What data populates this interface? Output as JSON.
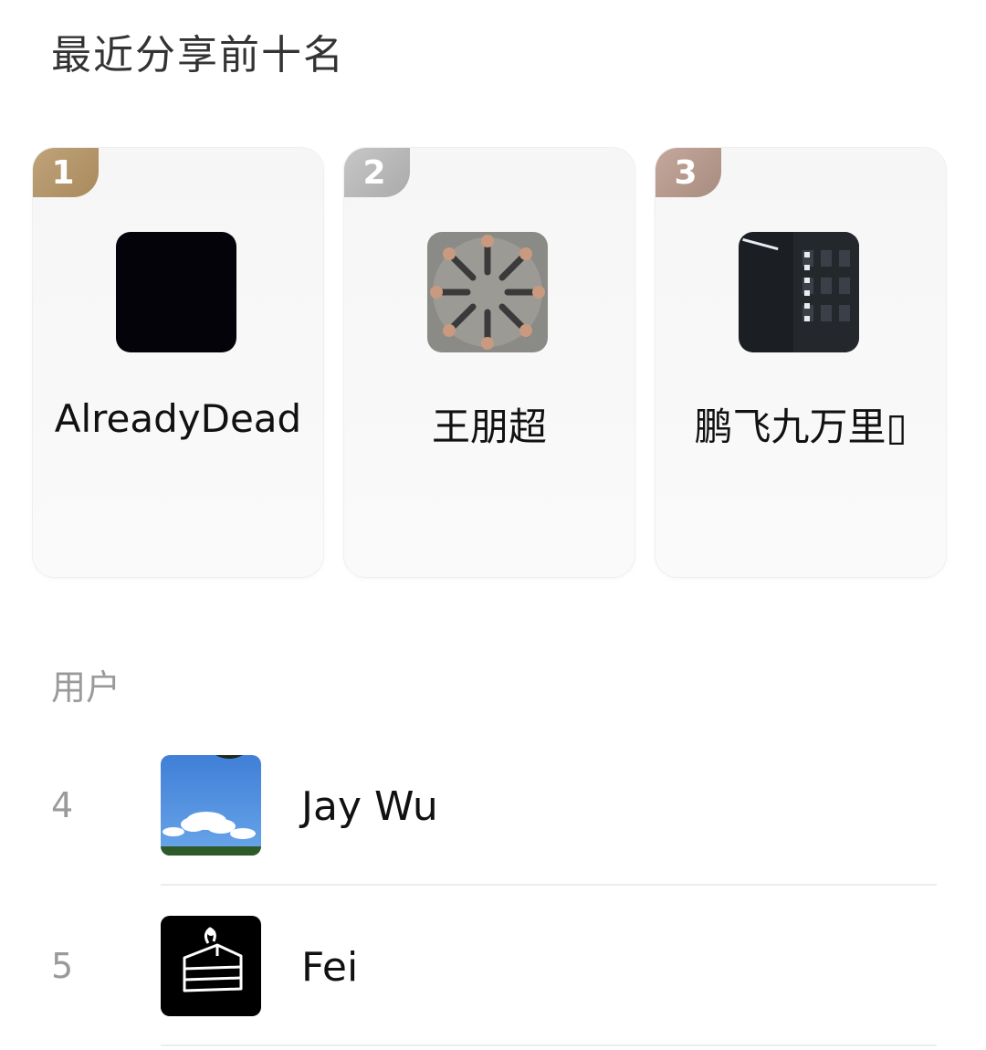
{
  "page": {
    "title": "最近分享前十名"
  },
  "top3": [
    {
      "rank": "1",
      "name": "AlreadyDead",
      "avatar": "black-square-avatar"
    },
    {
      "rank": "2",
      "name": "王朋超",
      "avatar": "hands-with-pistols-avatar"
    },
    {
      "rank": "3",
      "name": "鹏飞九万里▯",
      "avatar": "building-night-sign-avatar"
    }
  ],
  "section": {
    "label": "用户"
  },
  "list": [
    {
      "rank": "4",
      "name": "Jay Wu",
      "avatar": "blue-sky-clouds-avatar"
    },
    {
      "rank": "5",
      "name": "Fei",
      "avatar": "cake-is-a-lie-avatar"
    }
  ],
  "colors": {
    "gold": "#bfa37a",
    "silver": "#c7c7c7",
    "bronze": "#c4a89b"
  }
}
